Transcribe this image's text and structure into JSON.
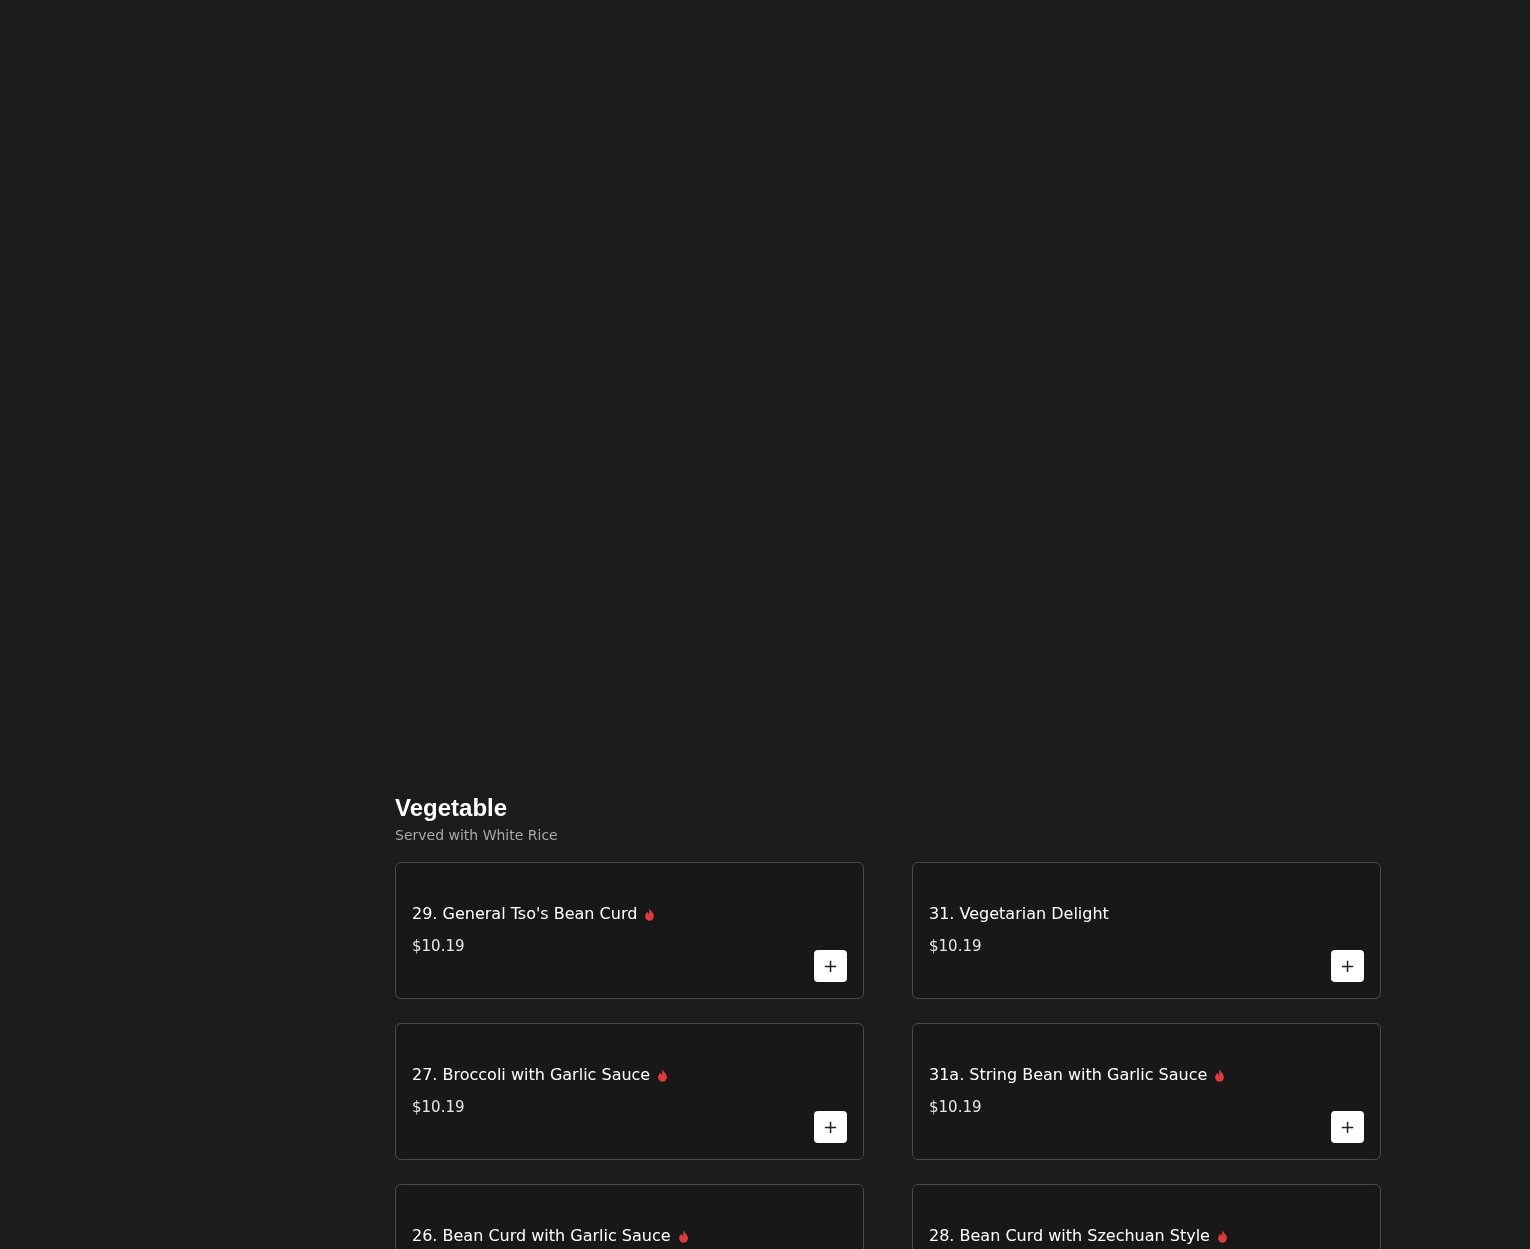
{
  "section": {
    "title": "Vegetable",
    "subtitle": "Served with White Rice"
  },
  "items": [
    {
      "name": "29. General Tso's Bean Curd",
      "spicy": true,
      "price": "$10.19",
      "add_button": "+"
    },
    {
      "name": "31. Vegetarian Delight",
      "spicy": false,
      "price": "$10.19",
      "add_button": "+"
    },
    {
      "name": "27. Broccoli with Garlic Sauce",
      "spicy": true,
      "price": "$10.19",
      "add_button": "+"
    },
    {
      "name": "31a. String Bean with Garlic Sauce",
      "spicy": true,
      "price": "$10.19",
      "add_button": "+"
    },
    {
      "name": "26. Bean Curd with Garlic Sauce",
      "spicy": true
    },
    {
      "name": "28. Bean Curd with Szechuan Style",
      "spicy": true
    }
  ]
}
